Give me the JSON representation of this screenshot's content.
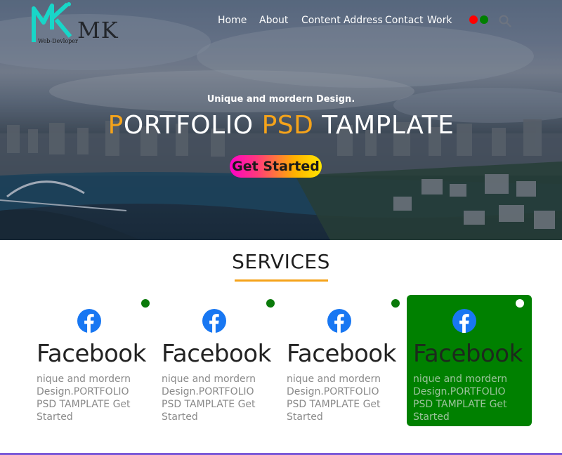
{
  "logo": {
    "monogram": "MK",
    "name": "MK",
    "tagline": "Web-Devloper"
  },
  "nav": {
    "items": [
      "Home",
      "About",
      "Content",
      "Address",
      "Contact",
      "Work"
    ]
  },
  "header_dots": [
    "#ff0000",
    "#008000"
  ],
  "search": {
    "icon": "search-icon"
  },
  "hero": {
    "subtitle": "Unique and mordern Design.",
    "title_p": "P",
    "title_rest1": "ORTFOLIO ",
    "title_psd": "PSD",
    "title_rest2": " TAMPLATE",
    "cta": "Get Started"
  },
  "services": {
    "title": "SERVICES",
    "cards": [
      {
        "icon": "facebook-icon",
        "title": "Facebook",
        "body": "nique and mordern Design.PORTFOLIO PSD TAMPLATE Get Started",
        "active": false
      },
      {
        "icon": "facebook-icon",
        "title": "Facebook",
        "body": "nique and mordern Design.PORTFOLIO PSD TAMPLATE Get Started",
        "active": false
      },
      {
        "icon": "facebook-icon",
        "title": "Facebook",
        "body": "nique and mordern Design.PORTFOLIO PSD TAMPLATE Get Started",
        "active": false
      },
      {
        "icon": "facebook-icon",
        "title": "Facebook",
        "body": "nique and mordern Design.PORTFOLIO PSD TAMPLATE Get Started",
        "active": true
      }
    ]
  },
  "colors": {
    "accent": "#f5a31a",
    "active_card": "#008000",
    "facebook": "#1877f2",
    "bottom_line": "#7a5ad8"
  }
}
